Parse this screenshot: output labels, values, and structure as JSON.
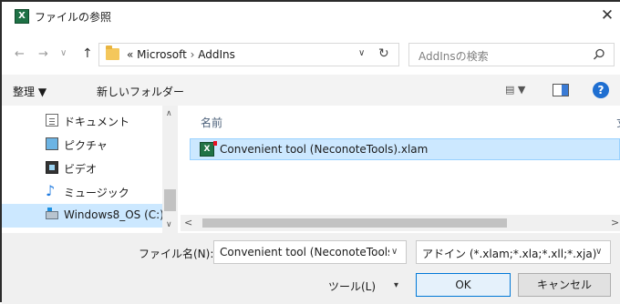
{
  "window": {
    "title": "ファイルの参照",
    "app_icon_letter": "X",
    "close_glyph": "✕"
  },
  "nav": {
    "back_glyph": "←",
    "forward_glyph": "→",
    "recent_glyph": "∨",
    "up_glyph": "↑"
  },
  "address": {
    "overflow": "«",
    "segments": [
      "Microsoft",
      "AddIns"
    ],
    "separator": "›",
    "dropdown_glyph": "∨",
    "refresh_glyph": "↻"
  },
  "search": {
    "placeholder": "AddInsの検索"
  },
  "toolbar": {
    "organize_label": "整理 ▼",
    "new_folder_label": "新しいフォルダー",
    "view_label": "▤ ▼",
    "help_label": "?"
  },
  "sidebar": {
    "items": [
      {
        "label": "ドキュメント",
        "icon": "document-icon"
      },
      {
        "label": "ピクチャ",
        "icon": "pictures-icon"
      },
      {
        "label": "ビデオ",
        "icon": "videos-icon"
      },
      {
        "label": "ミュージック",
        "icon": "music-icon"
      },
      {
        "label": "Windows8_OS (C:)",
        "icon": "drive-icon",
        "selected": true
      }
    ],
    "scroll_up": "∧",
    "scroll_down": "∨"
  },
  "filelist": {
    "column_name": "名前",
    "column_edge": "丈",
    "files": [
      {
        "name": "Convenient tool (NeconoteTools).xlam",
        "icon": "excel-addin-icon",
        "selected": true
      }
    ],
    "scroll_left": "<",
    "scroll_right": ">"
  },
  "bottom": {
    "filename_label": "ファイル名(N):",
    "filename_value": "Convenient tool (NeconoteTools).xlam",
    "filetype_value": "アドイン (*.xlam;*.xla;*.xll;*.xja)",
    "tools_label": "ツール(L)",
    "tools_drop": "▾",
    "ok_label": "OK",
    "cancel_label": "キャンセル",
    "drop_glyph": "∨"
  },
  "colors": {
    "selection": "#cce8ff",
    "accent": "#0078d7",
    "folder": "#f4c75b",
    "excel": "#217346"
  }
}
